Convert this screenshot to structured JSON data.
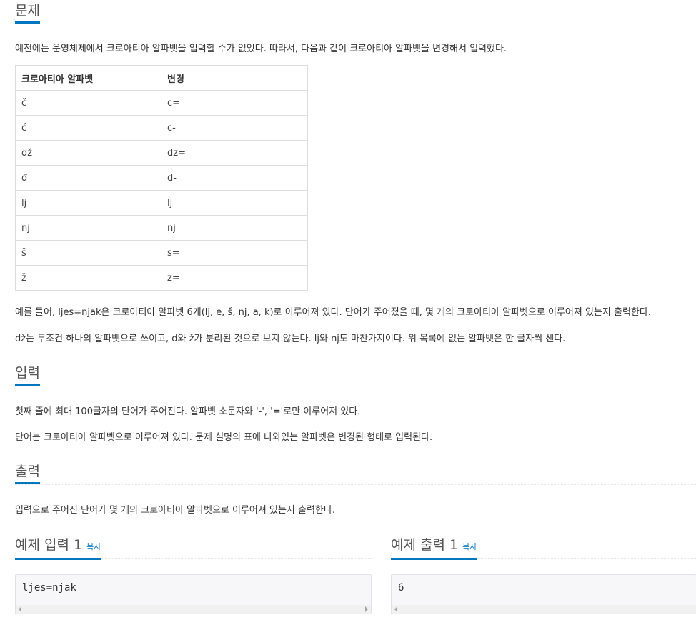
{
  "problem": {
    "heading": "문제",
    "intro": "예전에는 운영체제에서 크로아티아 알파벳을 입력할 수가 없었다. 따라서, 다음과 같이 크로아티아 알파벳을 변경해서 입력했다.",
    "table": {
      "headers": [
        "크로아티아 알파벳",
        "변경"
      ],
      "rows": [
        [
          "č",
          "c="
        ],
        [
          "ć",
          "c-"
        ],
        [
          "dž",
          "dz="
        ],
        [
          "đ",
          "d-"
        ],
        [
          "lj",
          "lj"
        ],
        [
          "nj",
          "nj"
        ],
        [
          "š",
          "s="
        ],
        [
          "ž",
          "z="
        ]
      ]
    },
    "para1": "예를 들어, ljes=njak은 크로아티아 알파벳 6개(lj, e, š, nj, a, k)로 이루어져 있다. 단어가 주어졌을 때, 몇 개의 크로아티아 알파벳으로 이루어져 있는지 출력한다.",
    "para2": "dž는 무조건 하나의 알파벳으로 쓰이고, d와 ž가 분리된 것으로 보지 않는다. lj와 nj도 마찬가지이다. 위 목록에 없는 알파벳은 한 글자씩 센다."
  },
  "input": {
    "heading": "입력",
    "line1": "첫째 줄에 최대 100글자의 단어가 주어진다. 알파벳 소문자와 '-', '='로만 이루어져 있다.",
    "line2": "단어는 크로아티아 알파벳으로 이루어져 있다. 문제 설명의 표에 나와있는 알파벳은 변경된 형태로 입력된다."
  },
  "output": {
    "heading": "출력",
    "line1": "입력으로 주어진 단어가 몇 개의 크로아티아 알파벳으로 이루어져 있는지 출력한다."
  },
  "sample_input": {
    "heading": "예제 입력 1",
    "copy_label": "복사",
    "code": "ljes=njak"
  },
  "sample_output": {
    "heading": "예제 출력 1",
    "copy_label": "복사",
    "code": "6"
  },
  "colors": {
    "accent": "#0076c0",
    "heading": "#555555",
    "text": "#333333",
    "border": "#dddddd"
  }
}
